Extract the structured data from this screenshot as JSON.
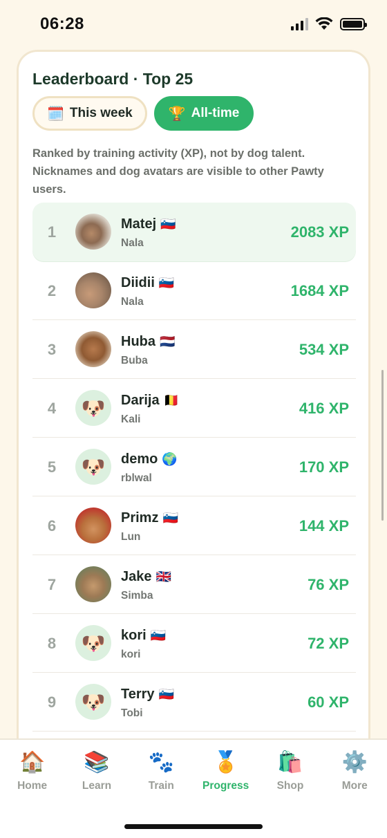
{
  "status_bar": {
    "time": "06:28"
  },
  "card": {
    "title": "Leaderboard · Top 25",
    "tabs": [
      {
        "label": "This week",
        "icon": "🗓️",
        "active": false
      },
      {
        "label": "All-time",
        "icon": "🏆",
        "active": true
      }
    ],
    "notice": "Ranked by training activity (XP), not by dog talent. Nicknames and dog avatars are visible to other Pawty users."
  },
  "leaderboard": [
    {
      "rank": "1",
      "user": "Matej",
      "flag": "🇸🇮",
      "dog": "Nala",
      "xp": "2083 XP",
      "avatar": "photo"
    },
    {
      "rank": "2",
      "user": "Diidii",
      "flag": "🇸🇮",
      "dog": "Nala",
      "xp": "1684 XP",
      "avatar": "photo"
    },
    {
      "rank": "3",
      "user": "Huba",
      "flag": "🇳🇱",
      "dog": "Buba",
      "xp": "534 XP",
      "avatar": "photo"
    },
    {
      "rank": "4",
      "user": "Darija",
      "flag": "🇧🇪",
      "dog": "Kali",
      "xp": "416 XP",
      "avatar": "🐶"
    },
    {
      "rank": "5",
      "user": "demo",
      "flag": "🌍",
      "dog": "rblwal",
      "xp": "170 XP",
      "avatar": "🐶"
    },
    {
      "rank": "6",
      "user": "Primz",
      "flag": "🇸🇮",
      "dog": "Lun",
      "xp": "144 XP",
      "avatar": "photo"
    },
    {
      "rank": "7",
      "user": "Jake",
      "flag": "🇬🇧",
      "dog": "Simba",
      "xp": "76 XP",
      "avatar": "photo"
    },
    {
      "rank": "8",
      "user": "kori",
      "flag": "🇸🇮",
      "dog": "kori",
      "xp": "72 XP",
      "avatar": "🐶"
    },
    {
      "rank": "9",
      "user": "Terry",
      "flag": "🇸🇮",
      "dog": "Tobi",
      "xp": "60 XP",
      "avatar": "🐶"
    }
  ],
  "nav": [
    {
      "label": "Home",
      "icon": "🏠"
    },
    {
      "label": "Learn",
      "icon": "📚"
    },
    {
      "label": "Train",
      "icon": "🐾"
    },
    {
      "label": "Progress",
      "icon": "🏅",
      "active": true
    },
    {
      "label": "Shop",
      "icon": "🛍️"
    },
    {
      "label": "More",
      "icon": "⚙️"
    }
  ],
  "colors": {
    "accent": "#2fb46b",
    "background": "#fdf7ea",
    "highlight_row": "#eef8ef"
  }
}
